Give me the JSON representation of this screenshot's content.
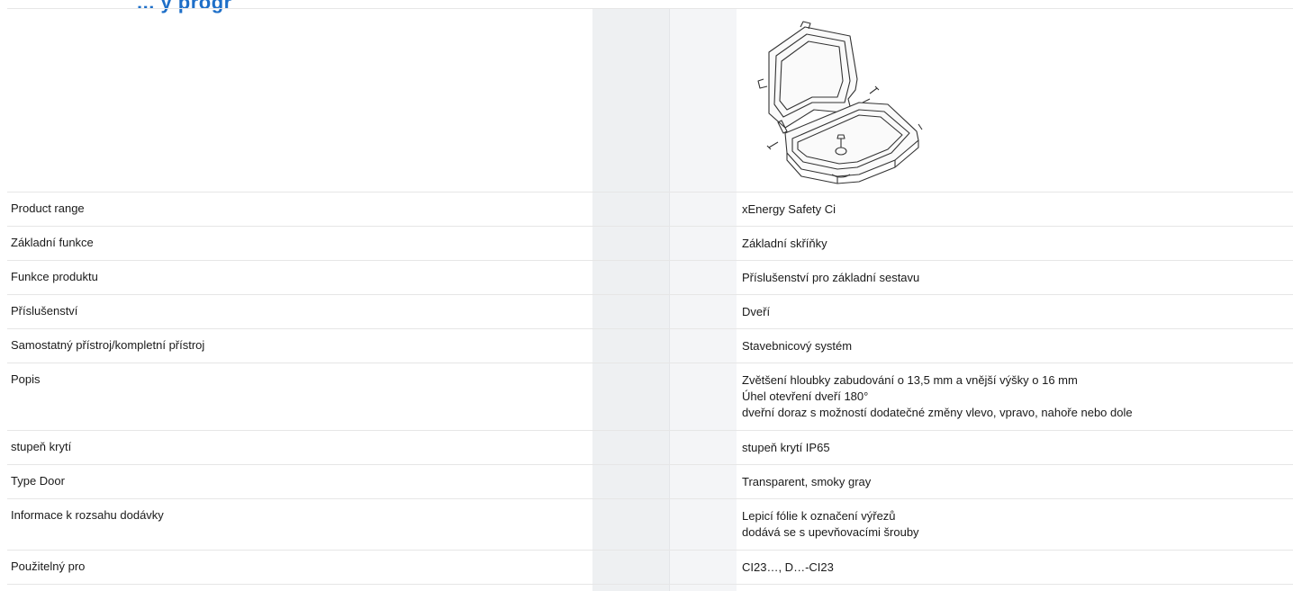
{
  "heading": "... y progr",
  "spec_table": {
    "rows": [
      {
        "label": "Product range",
        "value_lines": [
          "xEnergy Safety Ci"
        ]
      },
      {
        "label": "Základní funkce",
        "value_lines": [
          "Základní skříňky"
        ]
      },
      {
        "label": "Funkce produktu",
        "value_lines": [
          "Příslušenství pro základní sestavu"
        ]
      },
      {
        "label": "Příslušenství",
        "value_lines": [
          "Dveří"
        ]
      },
      {
        "label": "Samostatný přístroj/kompletní přístroj",
        "value_lines": [
          "Stavebnicový systém"
        ]
      },
      {
        "label": "Popis",
        "value_lines": [
          "Zvětšení hloubky zabudování o 13,5 mm a vnější výšky o 16 mm",
          "Úhel otevření dveří 180°",
          "dveřní doraz s možností dodatečné změny vlevo, vpravo, nahoře nebo dole"
        ]
      },
      {
        "label": "stupeň krytí",
        "value_lines": [
          "stupeň krytí IP65"
        ]
      },
      {
        "label": "Type Door",
        "value_lines": [
          "Transparent, smoky gray"
        ]
      },
      {
        "label": "Informace k rozsahu dodávky",
        "value_lines": [
          "Lepicí fólie k označení výřezů",
          "dodává se s upevňovacími šrouby"
        ]
      },
      {
        "label": "Použitelný pro",
        "value_lines": [
          "CI23…, D…-CI23"
        ]
      }
    ]
  },
  "colors": {
    "heading": "#1e6fc8",
    "band": "#eef0f2",
    "rule": "#e6e6e6"
  }
}
